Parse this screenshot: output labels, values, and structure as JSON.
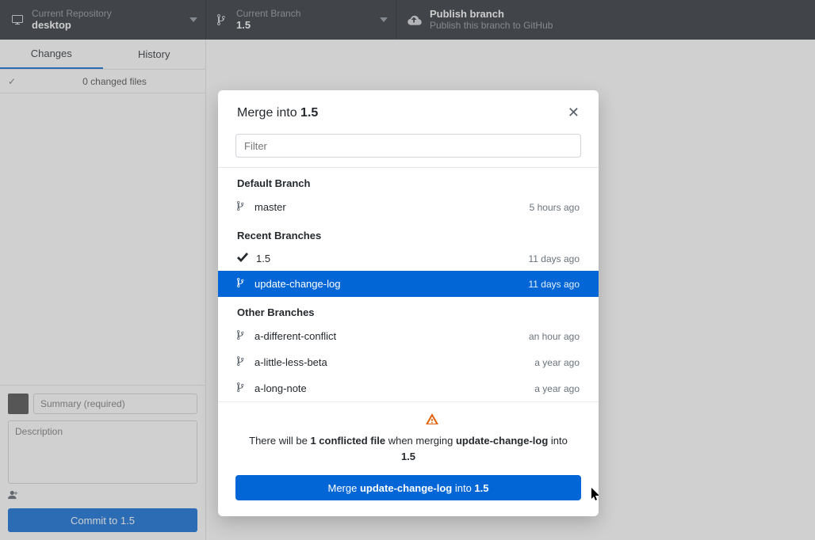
{
  "topbar": {
    "repo": {
      "label": "Current Repository",
      "value": "desktop"
    },
    "branch": {
      "label": "Current Branch",
      "value": "1.5"
    },
    "publish": {
      "label": "Publish branch",
      "value": "Publish this branch to GitHub"
    }
  },
  "sidebar": {
    "tabs": {
      "changes": "Changes",
      "history": "History"
    },
    "changed_files": "0 changed files",
    "summary_placeholder": "Summary (required)",
    "description_placeholder": "Description",
    "coauthor_icon": "add-coauthor",
    "commit_button": "Commit to 1.5"
  },
  "modal": {
    "title_prefix": "Merge into ",
    "title_branch": "1.5",
    "filter_placeholder": "Filter",
    "sections": {
      "default": "Default Branch",
      "recent": "Recent Branches",
      "other": "Other Branches"
    },
    "branches": {
      "default": [
        {
          "name": "master",
          "time": "5 hours ago",
          "icon": "branch",
          "selected": false
        }
      ],
      "recent": [
        {
          "name": "1.5",
          "time": "11 days ago",
          "icon": "check",
          "selected": false
        },
        {
          "name": "update-change-log",
          "time": "11 days ago",
          "icon": "branch",
          "selected": true
        }
      ],
      "other": [
        {
          "name": "a-different-conflict",
          "time": "an hour ago",
          "icon": "branch",
          "selected": false
        },
        {
          "name": "a-little-less-beta",
          "time": "a year ago",
          "icon": "branch",
          "selected": false
        },
        {
          "name": "a-long-note",
          "time": "a year ago",
          "icon": "branch",
          "selected": false
        }
      ]
    },
    "conflict": {
      "pre": "There will be ",
      "count": "1 conflicted file",
      "mid": " when merging ",
      "source": "update-change-log",
      "post": " into ",
      "target": "1.5"
    },
    "merge_button": {
      "pre": "Merge ",
      "source": "update-change-log",
      "mid": " into ",
      "target": "1.5"
    }
  }
}
